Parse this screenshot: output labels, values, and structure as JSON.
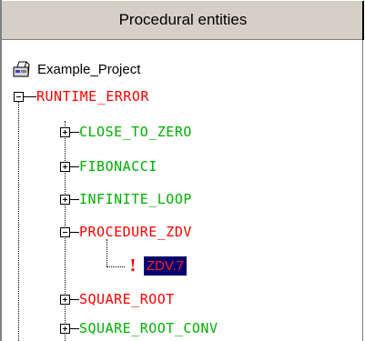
{
  "header": {
    "title": "Procedural entities"
  },
  "tree": {
    "root": {
      "label": "Example_Project",
      "icon": "project-icon"
    },
    "runtime_error": {
      "label": "RUNTIME_ERROR",
      "color": "#ff0000",
      "expanded": true
    },
    "children": [
      {
        "label": "CLOSE_TO_ZERO",
        "color": "#00b000",
        "expanded": false
      },
      {
        "label": "FIBONACCI",
        "color": "#00b000",
        "expanded": false
      },
      {
        "label": "INFINITE_LOOP",
        "color": "#00b000",
        "expanded": false
      },
      {
        "label": "PROCEDURE_ZDV",
        "color": "#ff0000",
        "expanded": true
      },
      {
        "label": "SQUARE_ROOT",
        "color": "#ff0000",
        "expanded": false
      },
      {
        "label": "SQUARE_ROOT_CONV",
        "color": "#00b000",
        "expanded": false
      }
    ],
    "procedure_zdv_child": {
      "label": "ZDV.7",
      "icon": "error-exclamation-icon",
      "selected": true
    }
  }
}
